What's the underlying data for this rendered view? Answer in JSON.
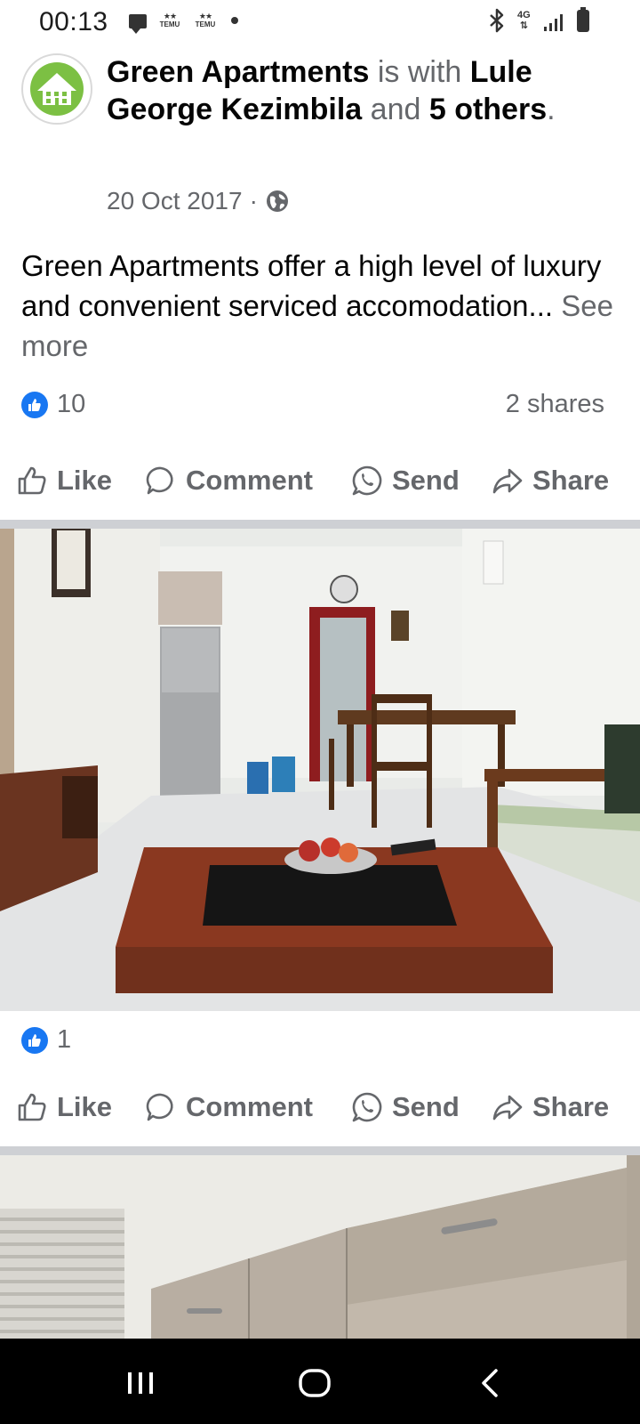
{
  "status_bar": {
    "time": "00:13",
    "notification_app_label": "TEMU",
    "network_label": "4G",
    "icons": [
      "message-icon",
      "temu-icon",
      "bluetooth-icon",
      "signal-icon",
      "battery-icon"
    ]
  },
  "post": {
    "page_name": "Green Apartments",
    "with_text": "is with",
    "tagged_person": "Lule George Kezimbila",
    "and_text": "and",
    "others_text": "5 others",
    "date": "20 Oct 2017",
    "separator": "·",
    "body_text": "Green Apartments offer a high level of luxury and convenient serviced accomodation...",
    "see_more_label": "See more",
    "reaction_count": "10",
    "shares_label": "2 shares"
  },
  "actions": {
    "like_label": "Like",
    "comment_label": "Comment",
    "send_label": "Send",
    "share_label": "Share"
  },
  "photo1": {
    "reaction_count": "1"
  },
  "colors": {
    "accent": "#1877f2",
    "secondary_text": "#65676b",
    "divider": "#ced0d4",
    "logo_green": "#7cc043"
  }
}
